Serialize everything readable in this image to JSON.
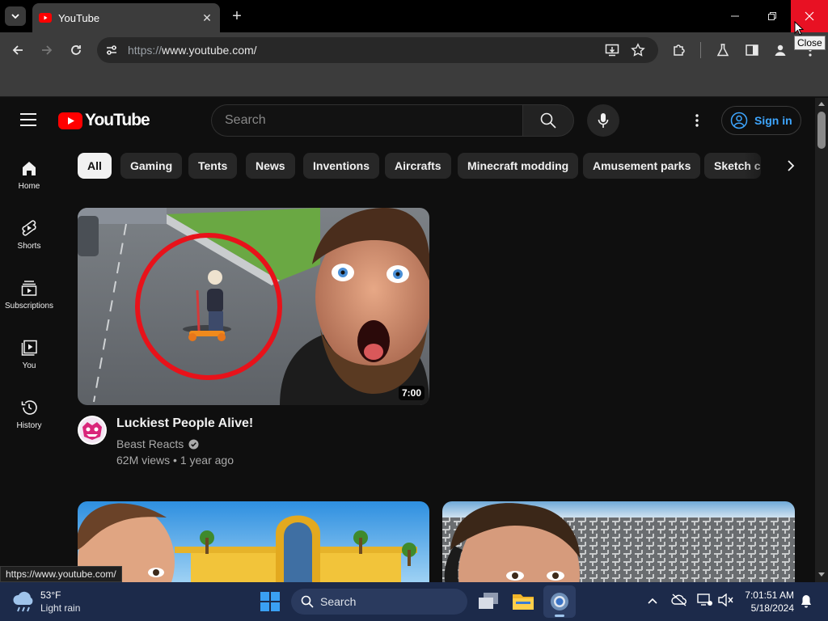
{
  "browser": {
    "tab_title": "YouTube",
    "url_prefix": "https://",
    "url_host": "www.youtube.com/",
    "tooltip": "Close"
  },
  "youtube": {
    "logo_text": "YouTube",
    "search_placeholder": "Search",
    "sign_in": "Sign in",
    "chips": [
      "All",
      "Gaming",
      "Tents",
      "News",
      "Inventions",
      "Aircrafts",
      "Minecraft modding",
      "Amusement parks",
      "Sketch c"
    ],
    "guide": [
      {
        "label": "Home",
        "icon": "home-icon"
      },
      {
        "label": "Shorts",
        "icon": "shorts-icon"
      },
      {
        "label": "Subscriptions",
        "icon": "subscriptions-icon"
      },
      {
        "label": "You",
        "icon": "you-icon"
      },
      {
        "label": "History",
        "icon": "history-icon"
      }
    ],
    "video": {
      "title": "Luckiest People Alive!",
      "channel": "Beast Reacts",
      "views": "62M views",
      "age": "1 year ago",
      "duration": "7:00"
    }
  },
  "status_bar_url": "https://www.youtube.com/",
  "taskbar": {
    "temperature": "53°F",
    "weather": "Light rain",
    "search": "Search",
    "time": "7:01:51 AM",
    "date": "5/18/2024"
  },
  "colors": {
    "youtube_red": "#ff0000",
    "link_blue": "#3ea6ff",
    "close_red": "#e81123"
  }
}
